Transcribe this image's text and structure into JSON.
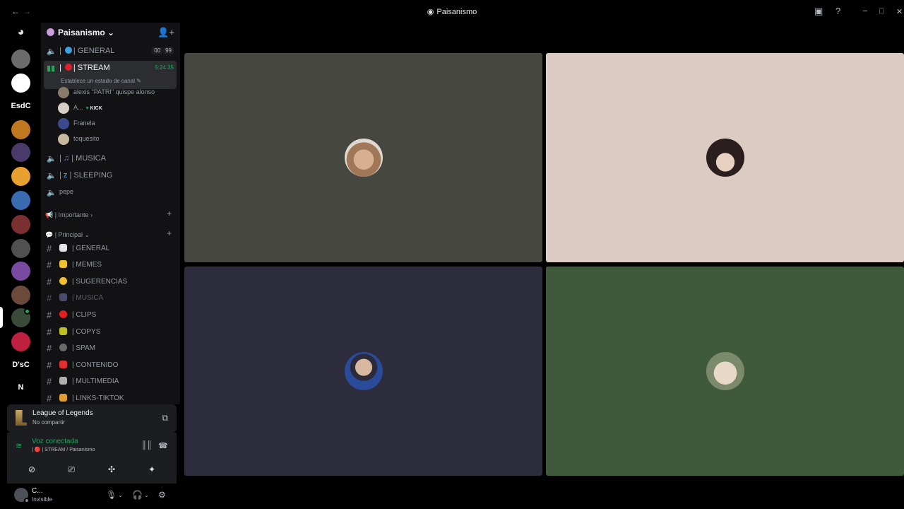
{
  "window": {
    "title": "Paisanismo",
    "nav_back": "←",
    "nav_forward": "→",
    "controls": {
      "inbox": "▣",
      "help": "?",
      "minimize": "−",
      "maximize": "□",
      "close": "✕"
    }
  },
  "rail": {
    "servers": [
      {
        "label": "",
        "color": "#5865f2",
        "icon": "discord-home-icon"
      },
      {
        "label": "",
        "color": "#6b6b6b"
      },
      {
        "label": "",
        "color": "#ffffff"
      },
      {
        "label": "EsdC",
        "color": "transparent"
      },
      {
        "label": "",
        "color": "#d08a20"
      },
      {
        "label": "",
        "color": "#4a3a6a"
      },
      {
        "label": "",
        "color": "#e8a030"
      },
      {
        "label": "",
        "color": "#3a6ab0"
      },
      {
        "label": "",
        "color": "#7a3030"
      },
      {
        "label": "",
        "color": "#505050"
      },
      {
        "label": "",
        "color": "#7a4aa0"
      },
      {
        "label": "",
        "color": "#6a4a3a"
      },
      {
        "label": "",
        "color": "#3a4a3a"
      },
      {
        "label": "",
        "color": "#c02040"
      },
      {
        "label": "D'sC",
        "color": "transparent"
      },
      {
        "label": "N",
        "color": "transparent"
      }
    ]
  },
  "server": {
    "name": "Paisanismo ⌄",
    "voice_channels": [
      {
        "emoji_color": "#3fa0e0",
        "name": "GENERAL",
        "badges": [
          "00",
          "99"
        ]
      },
      {
        "emoji_color": "#e0202a",
        "name": "STREAM",
        "timer": "5:24:35",
        "status": "Establece un estado de canal ✎"
      }
    ],
    "stream_members": [
      {
        "name": "alexis \"PATRI\" quispe alonso",
        "color": "#8a7a6a"
      },
      {
        "name": "A...",
        "color": "#d8d0c8",
        "tag": "KICK",
        "tag_icon": "💚"
      },
      {
        "name": "Franela",
        "color": "#3a4a8a"
      },
      {
        "name": "toquesito",
        "color": "#c8b8a0"
      }
    ],
    "voice_channels_2": [
      {
        "emoji": "🎵",
        "name": "MUSICA"
      },
      {
        "emoji": "💤",
        "name": "SLEEPING"
      },
      {
        "emoji": "",
        "name": "pepe"
      }
    ],
    "categories": {
      "importante": "📢 | Importante ›",
      "principal": "💬 | Principal ⌄"
    },
    "text_channels": [
      {
        "name": "GENERAL",
        "emoji_color": "#e3e5e8",
        "muted": false
      },
      {
        "name": "MEMES",
        "emoji_color": "#f0c030",
        "muted": false
      },
      {
        "name": "SUGERENCIAS",
        "emoji_color": "#f0c030",
        "muted": false
      },
      {
        "name": "MUSICA",
        "emoji_color": "#4a4a6a",
        "muted": true
      },
      {
        "name": "CLIPS",
        "emoji_color": "#e02020",
        "muted": false
      },
      {
        "name": "COPYS",
        "emoji_color": "#c0c020",
        "muted": false
      },
      {
        "name": "SPAM",
        "emoji_color": "#6a6a6a",
        "muted": false
      },
      {
        "name": "CONTENIDO",
        "emoji_color": "#e03030",
        "muted": false
      },
      {
        "name": "MULTIMEDIA",
        "emoji_color": "#b0b0b0",
        "muted": false
      },
      {
        "name": "LINKS-TIKTOK",
        "emoji_color": "#e0a030",
        "muted": false
      }
    ]
  },
  "activity": {
    "game": "League of Legends",
    "share": "No compartir"
  },
  "voice_panel": {
    "status": "Voz conectada",
    "channel": "| 🔴 | STREAM / Paisanismo"
  },
  "user": {
    "name": "C...",
    "status": "Invisible"
  },
  "tiles": [
    {
      "bg": "#464741",
      "face": "#b09070"
    },
    {
      "bg": "#dccbc3",
      "face": "#3a2a2a"
    },
    {
      "bg": "#2c2c3c",
      "face": "#2a3a6a"
    },
    {
      "bg": "#3f5a3b",
      "face": "#c8b098"
    }
  ]
}
